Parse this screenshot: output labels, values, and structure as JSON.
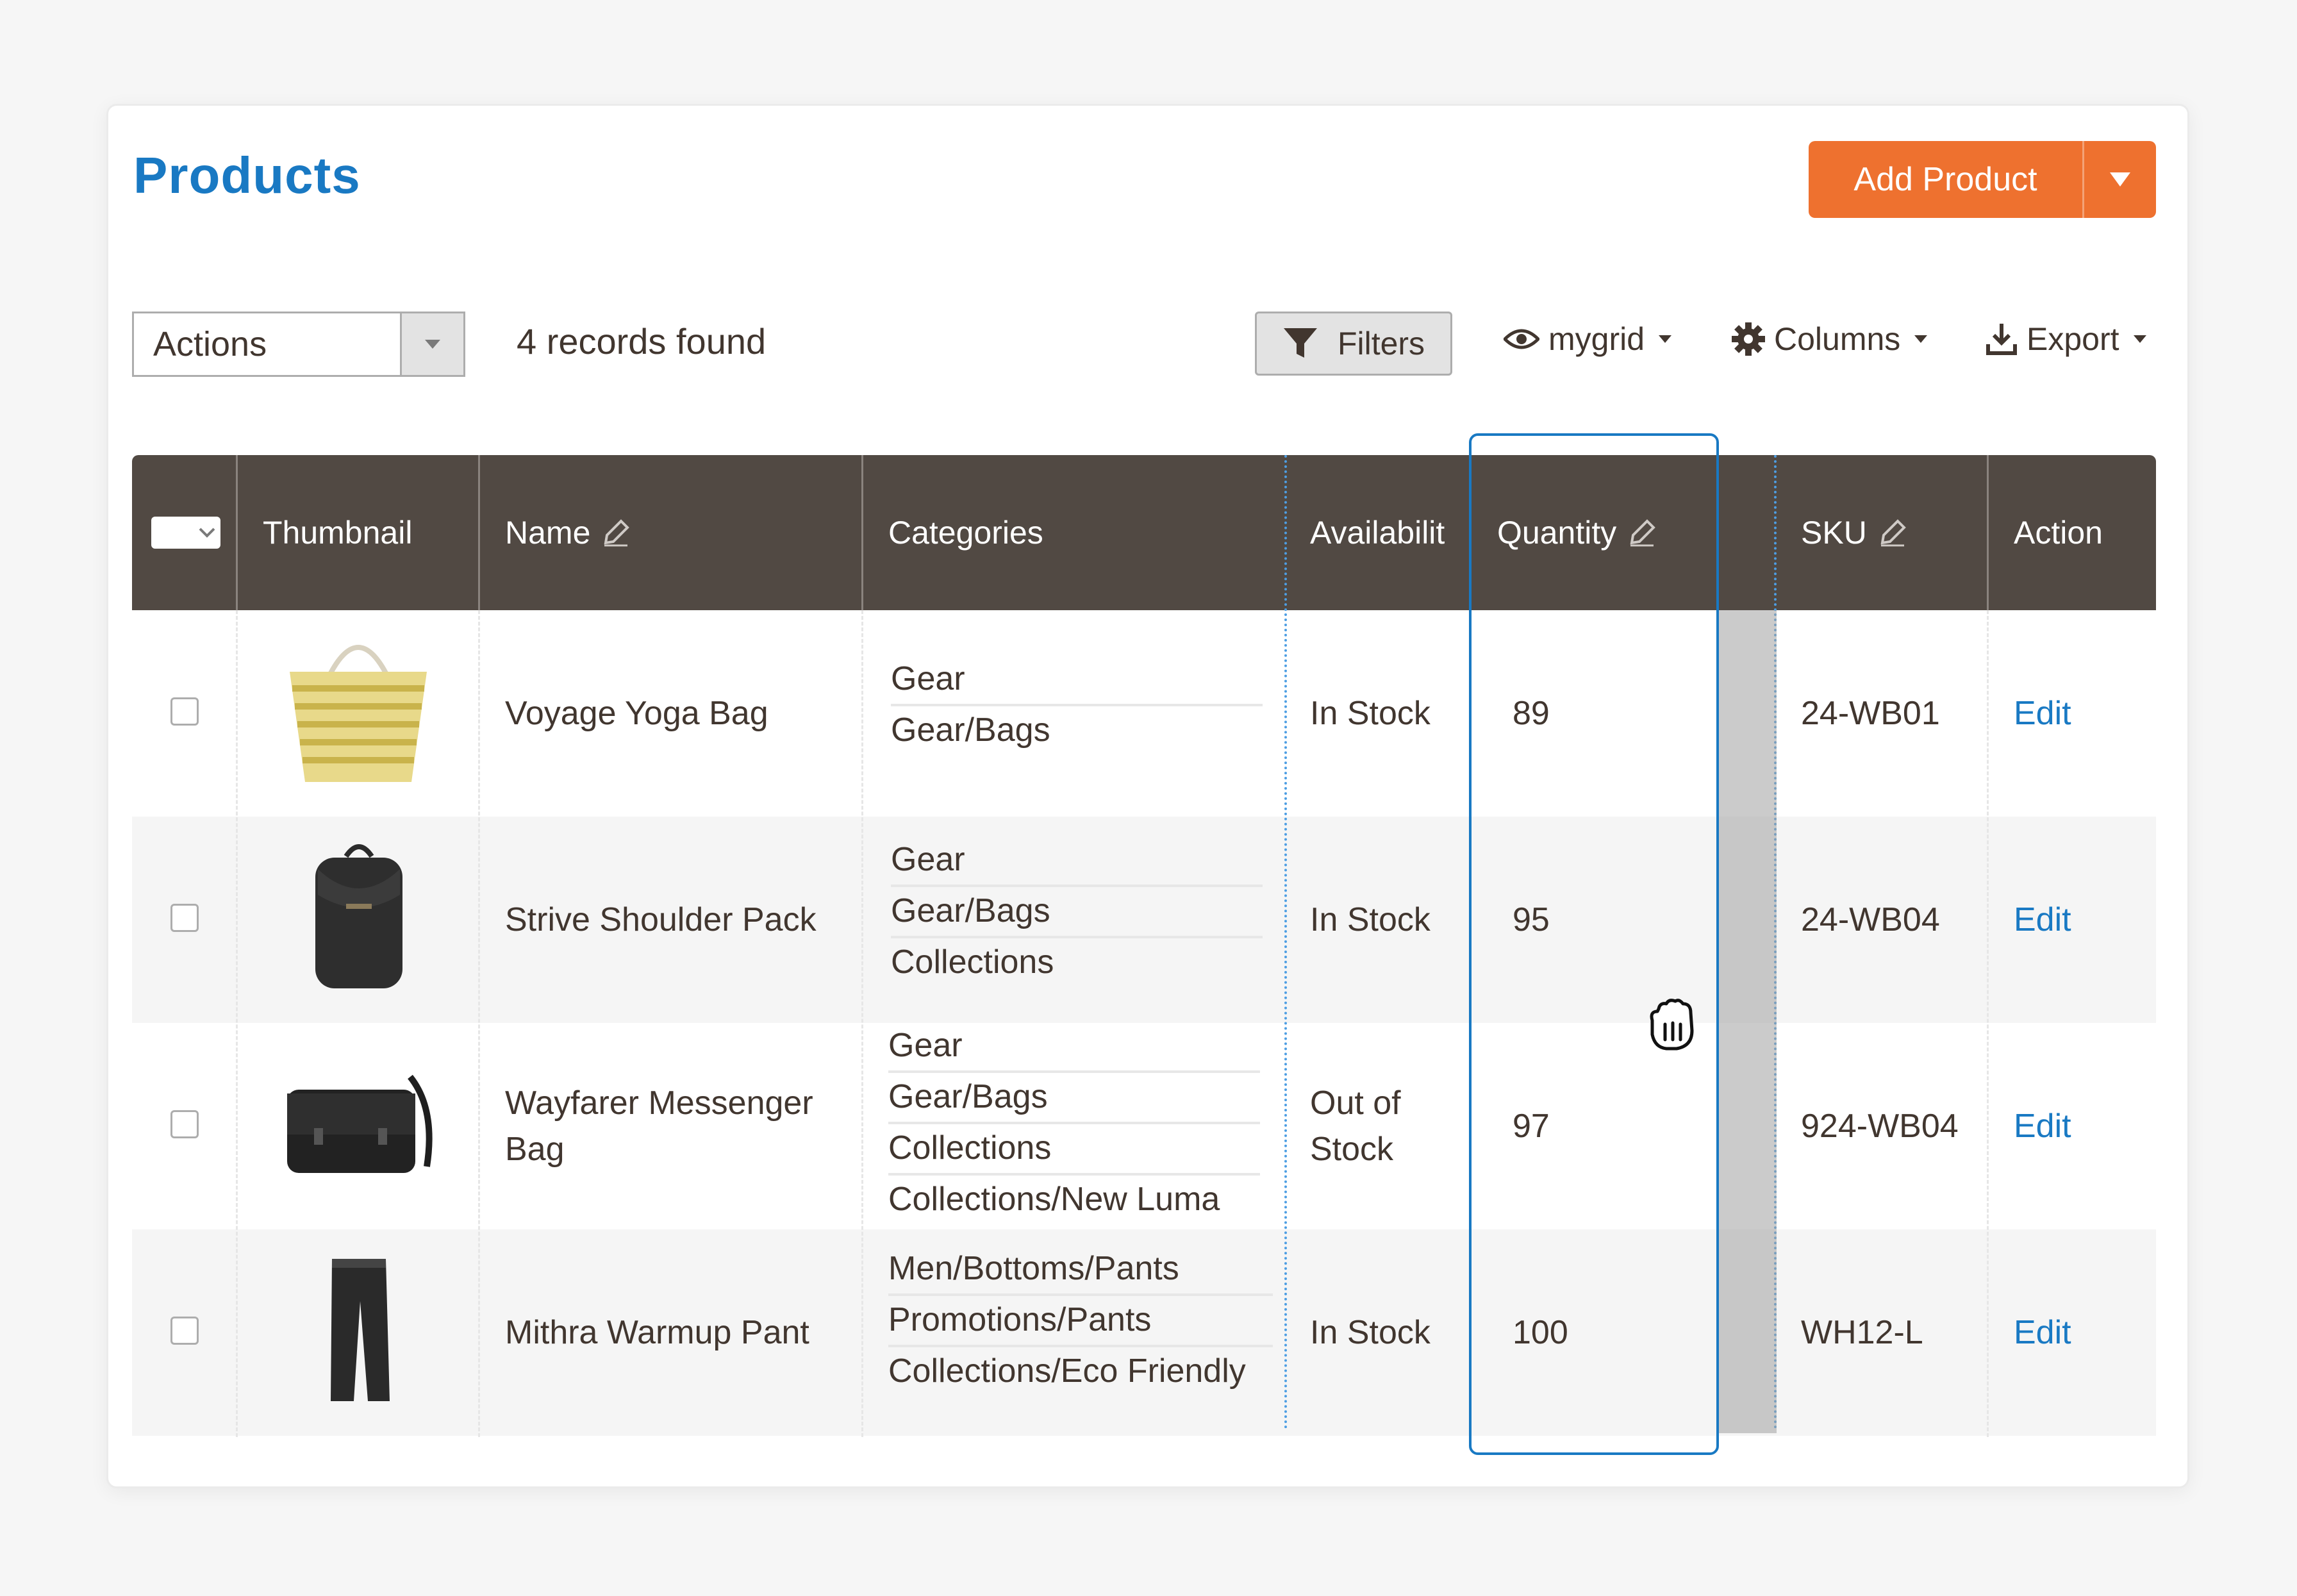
{
  "page": {
    "title": "Products",
    "add_button": "Add Product"
  },
  "toolbar": {
    "actions_label": "Actions",
    "records_found": "4 records found",
    "filters_label": "Filters",
    "view_label": "mygrid",
    "columns_label": "Columns",
    "export_label": "Export"
  },
  "grid": {
    "headers": {
      "thumbnail": "Thumbnail",
      "name": "Name",
      "categories": "Categories",
      "availability": "Availabilit",
      "quantity": "Quantity",
      "sku": "SKU",
      "action": "Action"
    },
    "rows": [
      {
        "name": "Voyage Yoga Bag",
        "categories": [
          "Gear",
          "Gear/Bags"
        ],
        "availability": "In Stock",
        "quantity": "89",
        "sku": "24-WB01",
        "action": "Edit",
        "thumbnail_icon": "yoga-bag-icon"
      },
      {
        "name": "Strive Shoulder Pack",
        "categories": [
          "Gear",
          "Gear/Bags",
          "Collections"
        ],
        "availability": "In Stock",
        "quantity": "95",
        "sku": "24-WB04",
        "action": "Edit",
        "thumbnail_icon": "backpack-icon"
      },
      {
        "name": "Wayfarer Messenger Bag",
        "categories": [
          "Gear",
          "Gear/Bags",
          "Collections",
          "Collections/New Luma"
        ],
        "availability": "Out of Stock",
        "quantity": "97",
        "sku": "924-WB04",
        "action": "Edit",
        "thumbnail_icon": "messenger-bag-icon"
      },
      {
        "name": "Mithra Warmup Pant",
        "categories": [
          "Men/Bottoms/Pants",
          "Promotions/Pants",
          "Collections/Eco Friendly"
        ],
        "availability": "In Stock",
        "quantity": "100",
        "sku": "WH12-L",
        "action": "Edit",
        "thumbnail_icon": "pants-icon"
      }
    ]
  },
  "colors": {
    "title": "#1979c3",
    "accent_button": "#eb5202",
    "header_bg": "#514943",
    "link": "#1979c3",
    "drag_column_border": "#1979c3"
  }
}
